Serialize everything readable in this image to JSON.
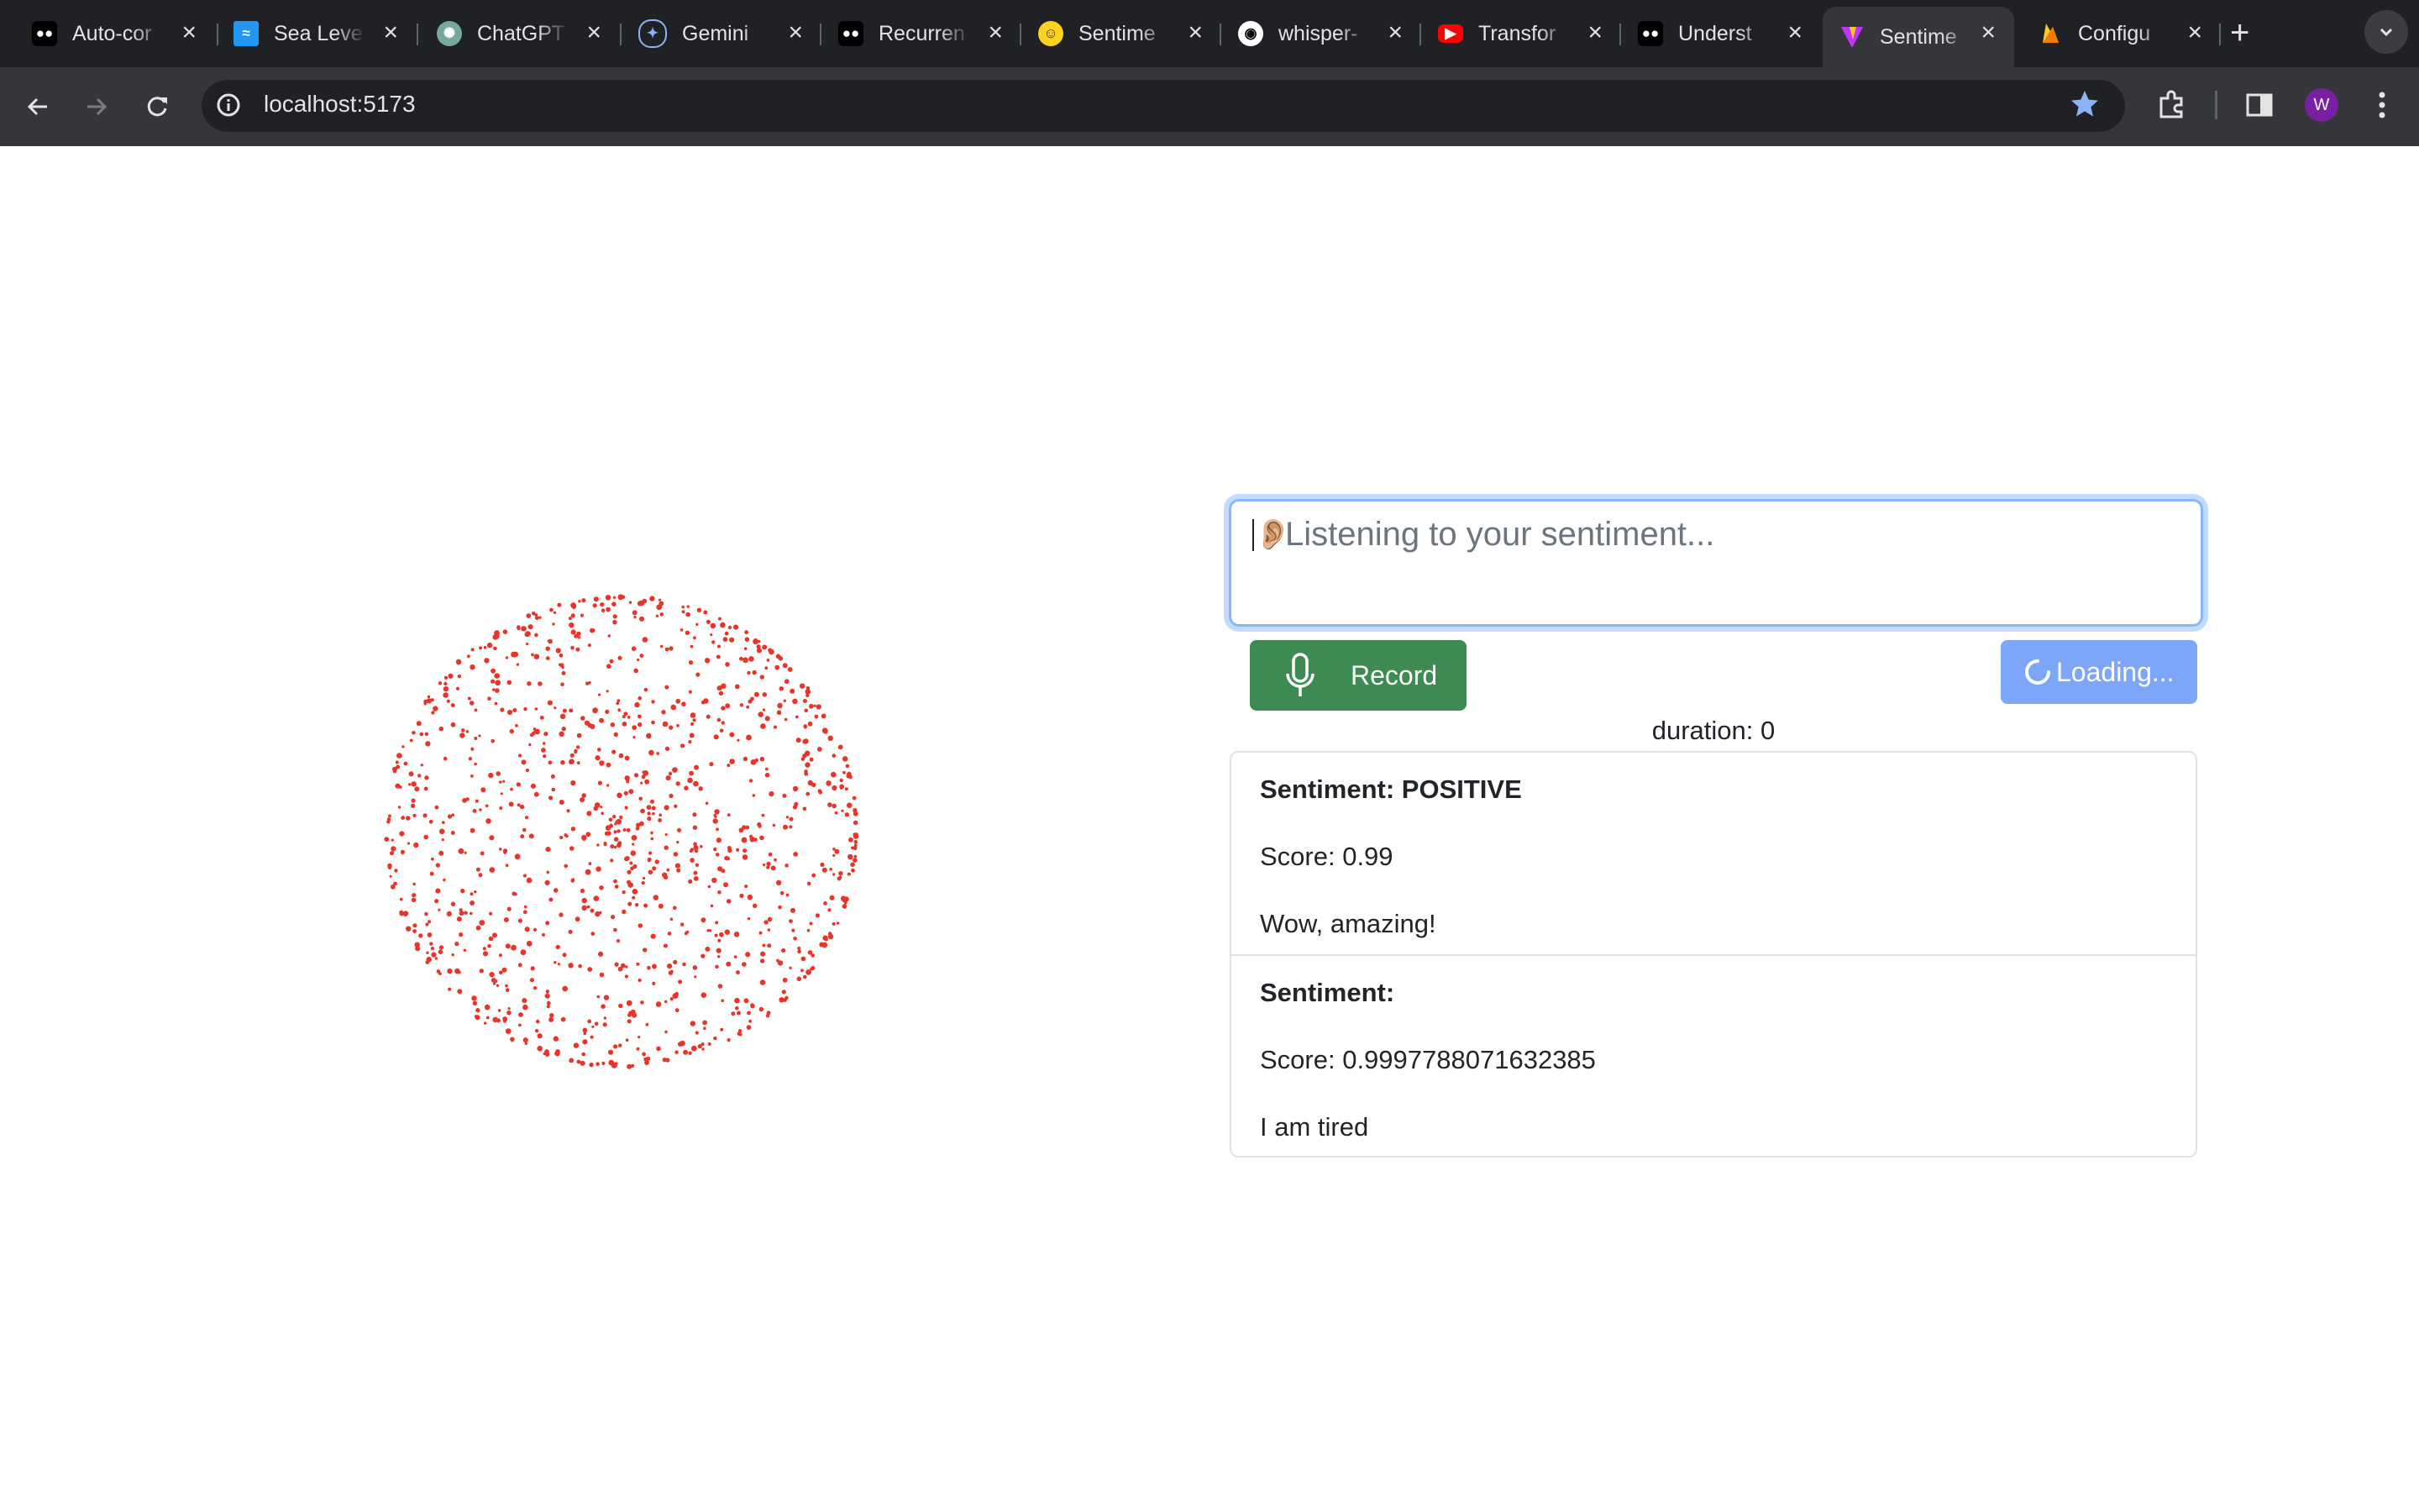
{
  "browser": {
    "tabs": [
      {
        "title": "Auto-cor",
        "favicon": "medium-icon",
        "color": "#000000"
      },
      {
        "title": "Sea Leve",
        "favicon": "sea-level-icon",
        "color": "#2196f3"
      },
      {
        "title": "ChatGPT",
        "favicon": "chatgpt-icon",
        "color": "#74aa9c"
      },
      {
        "title": "Gemini",
        "favicon": "gemini-icon",
        "color": "#4285f4"
      },
      {
        "title": "Recurren",
        "favicon": "medium-icon",
        "color": "#000000"
      },
      {
        "title": "Sentime",
        "favicon": "huggingface-icon",
        "color": "#ffd21e"
      },
      {
        "title": "whisper-",
        "favicon": "github-icon",
        "color": "#ffffff"
      },
      {
        "title": "Transfor",
        "favicon": "youtube-icon",
        "color": "#ff0000"
      },
      {
        "title": "Underst",
        "favicon": "medium-icon",
        "color": "#000000"
      },
      {
        "title": "Sentime",
        "favicon": "vite-icon",
        "color": "#bd34fe",
        "active": true
      },
      {
        "title": "Configu",
        "favicon": "firebase-icon",
        "color": "#ffca28"
      }
    ],
    "address": "localhost:5173",
    "profile_initial": "W"
  },
  "app": {
    "input": {
      "emoji": "👂🏼",
      "placeholder": "Listening to your sentiment..."
    },
    "record_label": "Record",
    "loading_label": "Loading...",
    "duration_text": "duration: 0",
    "results": [
      {
        "sentiment": "Sentiment: POSITIVE",
        "score": "Score: 0.99",
        "text": "Wow, amazing!"
      },
      {
        "sentiment": "Sentiment:",
        "score": "Score: 0.9997788071632385",
        "text": "I am tired"
      }
    ],
    "colors": {
      "accent": "#3d8a53",
      "loading": "#7ea6f8",
      "particles": "#e8352b",
      "focus_ring": "#86b7fe"
    }
  }
}
